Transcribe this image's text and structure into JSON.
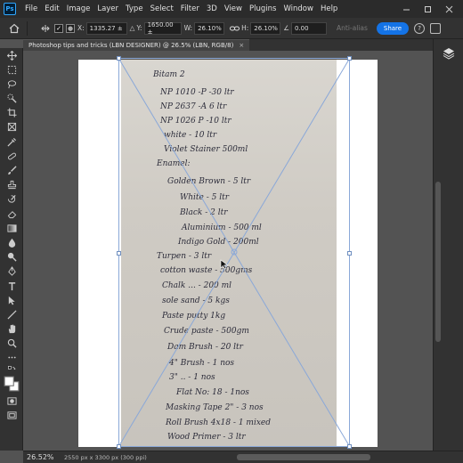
{
  "app": {
    "logo": "Ps"
  },
  "menu": [
    "File",
    "Edit",
    "Image",
    "Layer",
    "Type",
    "Select",
    "Filter",
    "3D",
    "View",
    "Plugins",
    "Window",
    "Help"
  ],
  "options": {
    "x_label": "X:",
    "x_value": "1335.27 ±",
    "y_label": "Y:",
    "y_value": "1650.00 ±",
    "w_label": "W:",
    "w_value": "26.10%",
    "h_label": "H:",
    "h_value": "26.10%",
    "angle_value": "0.00",
    "interp_label": "Anti-alias",
    "share_label": "Share",
    "help_glyph": "?"
  },
  "document": {
    "tab_title": "Photoshop tips and tricks (LBN DESIGNER) @ 26.5% (LBN, RGB/8)",
    "close_glyph": "×"
  },
  "note_lines": [
    "Bitam 2",
    "NP 1010 -P  -30 ltr",
    "NP 2637 -A   6 ltr",
    "NP 1026 P -10 ltr",
    "white  -  10 ltr",
    "Violet Stainer 500ml",
    "Enamel:",
    "Golden Brown - 5 ltr",
    "White  -  5 ltr",
    "Black  -  2 ltr",
    "Aluminium - 500 ml",
    "Indigo Gold - 200ml",
    "Turpen - 3 ltr",
    "cotton waste - 500gms",
    "Chalk ... - 200 ml",
    "sole sand - 5 kgs",
    "Paste putty 1kg",
    "Crude paste - 500gm",
    "Dam Brush - 20 ltr",
    "4\" Brush - 1 nos",
    "3\"  ..  - 1 nos",
    "Flat No: 18 - 1nos",
    "Masking Tape 2\" - 3 nos",
    "Roll Brush 4x18 - 1 mixed",
    "Wood Primer - 3 ltr"
  ],
  "status": {
    "zoom": "26.52%",
    "doc_size": "2550 px x 3300 px (300 ppi)"
  },
  "colors": {
    "accent": "#1473e6",
    "panel_bg": "#323232",
    "canvas_bg": "#535353",
    "bbox": "#8aa8d8"
  }
}
